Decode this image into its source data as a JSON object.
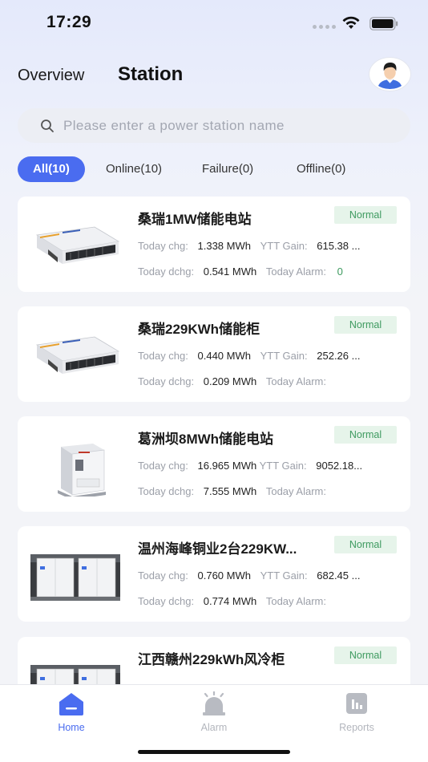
{
  "status": {
    "time": "17:29"
  },
  "header": {
    "tab_overview": "Overview",
    "tab_station": "Station"
  },
  "search": {
    "placeholder": "Please enter a power station name"
  },
  "filters": [
    "All(10)",
    "Online(10)",
    "Failure(0)",
    "Offline(0)"
  ],
  "colors": {
    "accent": "#4a6cf0",
    "status_normal": "#3d9a5f",
    "status_normal_bg": "#e6f4ea"
  },
  "labels": {
    "today_chg": "Today chg:",
    "today_dchg": "Today dchg:",
    "ytt_gain": "YTT Gain:",
    "today_alarm": "Today Alarm:"
  },
  "stations": [
    {
      "name": "桑瑞1MW储能电站",
      "status": "Normal",
      "today_chg": "1.338 MWh",
      "today_dchg": "0.541 MWh",
      "ytt_gain": "615.38 ...",
      "today_alarm": "0",
      "image": "battery-cabinets"
    },
    {
      "name": "桑瑞229KWh储能柜",
      "status": "Normal",
      "today_chg": "0.440 MWh",
      "today_dchg": "0.209 MWh",
      "ytt_gain": "252.26 ...",
      "today_alarm": "",
      "image": "battery-cabinets"
    },
    {
      "name": "葛洲坝8MWh储能电站",
      "status": "Normal",
      "today_chg": "16.965 MWh",
      "today_dchg": "7.555 MWh",
      "ytt_gain": "9052.18...",
      "today_alarm": "",
      "image": "single-cabinet"
    },
    {
      "name": "温州海峰铜业2台229KW...",
      "status": "Normal",
      "today_chg": "0.760 MWh",
      "today_dchg": "0.774 MWh",
      "ytt_gain": "682.45 ...",
      "today_alarm": "",
      "image": "installed-cabinets"
    },
    {
      "name": "江西赣州229kWh风冷柜",
      "status": "Normal",
      "today_chg": "",
      "today_dchg": "",
      "ytt_gain": "",
      "today_alarm": "",
      "image": "installed-cabinets"
    }
  ],
  "tabbar": [
    {
      "label": "Home",
      "icon": "home-icon",
      "active": true
    },
    {
      "label": "Alarm",
      "icon": "alarm-icon",
      "active": false
    },
    {
      "label": "Reports",
      "icon": "reports-icon",
      "active": false
    }
  ]
}
